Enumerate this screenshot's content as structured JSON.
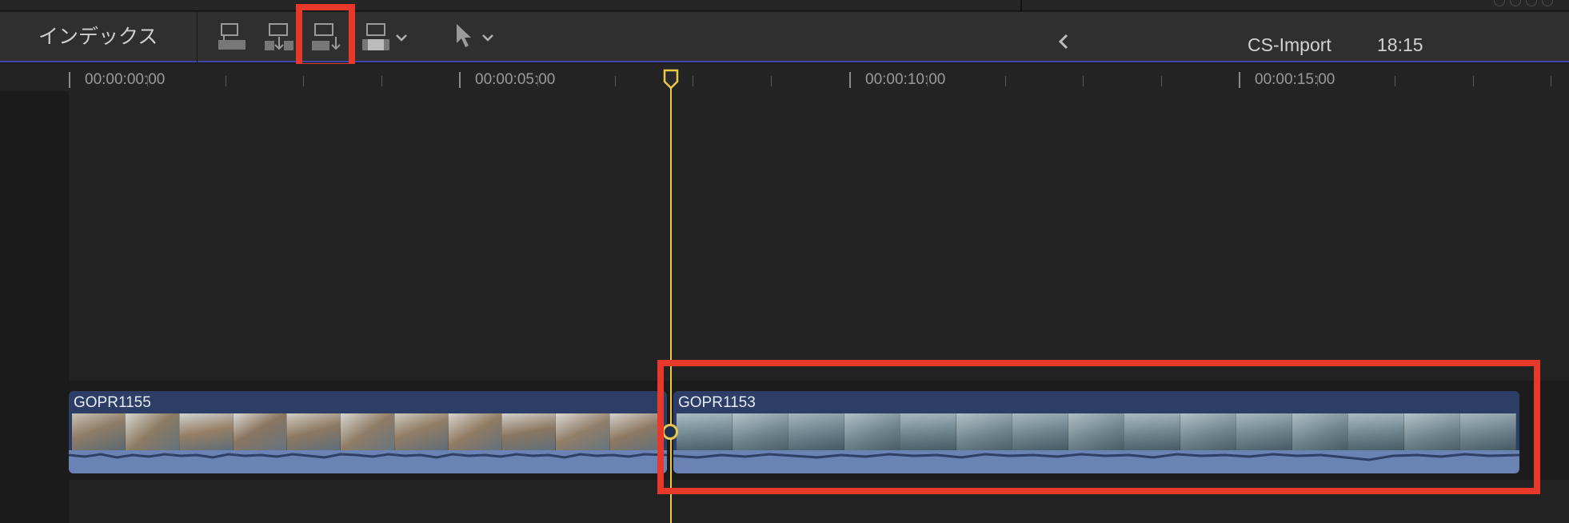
{
  "toolbar": {
    "index_label": "インデックス",
    "project_name": "CS-Import",
    "project_duration": "18:15",
    "tools": [
      {
        "name": "connect-clip",
        "icon": "connect-icon"
      },
      {
        "name": "insert-clip",
        "icon": "insert-icon"
      },
      {
        "name": "append-clip",
        "icon": "append-icon",
        "highlighted": true
      },
      {
        "name": "overwrite-clip",
        "icon": "overwrite-icon"
      },
      {
        "name": "select-tool",
        "icon": "arrow-pointer-icon"
      }
    ]
  },
  "ruler": {
    "timecodes": [
      "00:00:00:00",
      "00:00:05:00",
      "00:00:10:00",
      "00:00:15:00"
    ]
  },
  "clips": [
    {
      "name": "GOPR1155"
    },
    {
      "name": "GOPR1153",
      "highlighted": true
    }
  ],
  "colors": {
    "accent_highlight": "#e8382a",
    "playhead": "#e9c84a",
    "clip_body": "#2c3e66",
    "audio_wave": "#6b82b5",
    "toolbar_underline": "#3f46a8"
  }
}
